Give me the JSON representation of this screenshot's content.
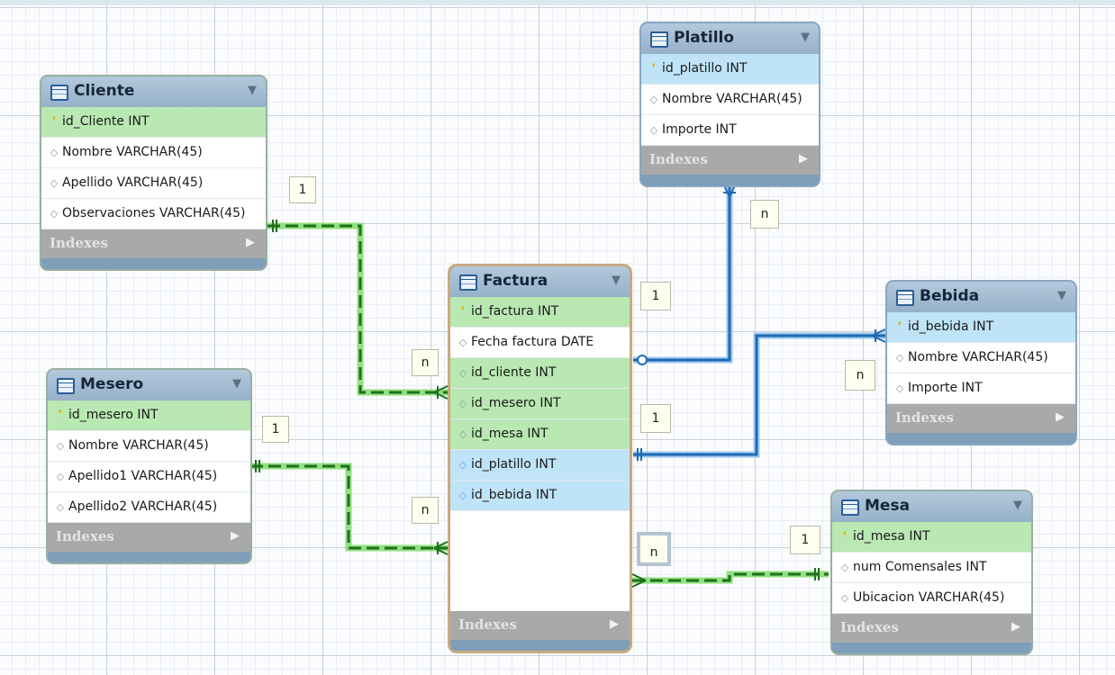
{
  "tables": {
    "cliente": {
      "name": "Cliente",
      "columns": [
        {
          "label": "id_Cliente INT",
          "kind": "pk"
        },
        {
          "label": "Nombre VARCHAR(45)",
          "kind": "col"
        },
        {
          "label": "Apellido VARCHAR(45)",
          "kind": "col"
        },
        {
          "label": "Observaciones VARCHAR(45)",
          "kind": "col"
        }
      ],
      "indexes_label": "Indexes"
    },
    "mesero": {
      "name": "Mesero",
      "columns": [
        {
          "label": "id_mesero INT",
          "kind": "pk"
        },
        {
          "label": "Nombre VARCHAR(45)",
          "kind": "col"
        },
        {
          "label": "Apellido1 VARCHAR(45)",
          "kind": "col"
        },
        {
          "label": "Apellido2 VARCHAR(45)",
          "kind": "col"
        }
      ],
      "indexes_label": "Indexes"
    },
    "factura": {
      "name": "Factura",
      "columns": [
        {
          "label": "id_factura INT",
          "kind": "pk"
        },
        {
          "label": "Fecha factura DATE",
          "kind": "col"
        },
        {
          "label": "id_cliente INT",
          "kind": "fk-green"
        },
        {
          "label": "id_mesero INT",
          "kind": "fk-green"
        },
        {
          "label": "id_mesa INT",
          "kind": "fk-green"
        },
        {
          "label": "id_platillo INT",
          "kind": "fk-blue"
        },
        {
          "label": "id_bebida INT",
          "kind": "fk-blue"
        }
      ],
      "indexes_label": "Indexes"
    },
    "platillo": {
      "name": "Platillo",
      "columns": [
        {
          "label": "id_platillo INT",
          "kind": "pk-blue"
        },
        {
          "label": "Nombre VARCHAR(45)",
          "kind": "col"
        },
        {
          "label": "Importe INT",
          "kind": "col"
        }
      ],
      "indexes_label": "Indexes"
    },
    "bebida": {
      "name": "Bebida",
      "columns": [
        {
          "label": "id_bebida INT",
          "kind": "pk-blue"
        },
        {
          "label": "Nombre VARCHAR(45)",
          "kind": "col"
        },
        {
          "label": "Importe INT",
          "kind": "col"
        }
      ],
      "indexes_label": "Indexes"
    },
    "mesa": {
      "name": "Mesa",
      "columns": [
        {
          "label": "id_mesa INT",
          "kind": "pk"
        },
        {
          "label": "num Comensales INT",
          "kind": "col"
        },
        {
          "label": "Ubicacion VARCHAR(45)",
          "kind": "col"
        }
      ],
      "indexes_label": "Indexes"
    }
  },
  "cardinality": {
    "cliente_one": "1",
    "cliente_many": "n",
    "mesero_one": "1",
    "mesero_many": "n",
    "platillo_one": "1",
    "platillo_many": "n",
    "bebida_one": "1",
    "bebida_many": "n",
    "mesa_one": "1",
    "mesa_many": "n"
  },
  "colors": {
    "identifying": "#1f9a1f",
    "identifying_glow": "#92e07f",
    "non_identifying": "#1e6bb3",
    "non_identifying_glow": "#9bc9ee"
  }
}
